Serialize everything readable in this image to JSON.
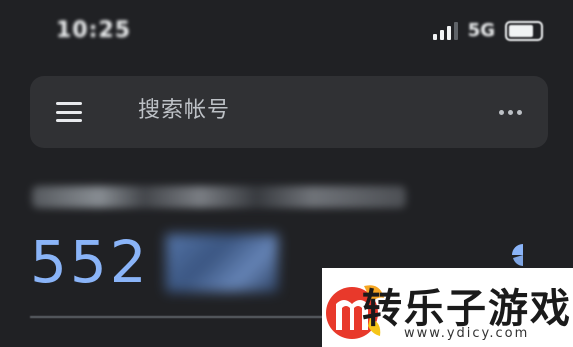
{
  "status_bar": {
    "time": "10:25",
    "network": "5G"
  },
  "search": {
    "placeholder": "搜索帐号"
  },
  "account": {
    "code_visible": "552"
  },
  "watermark": {
    "title": "转乐子游戏",
    "url": "www.ydicy.com"
  },
  "colors": {
    "background": "#202124",
    "search_bar": "#303134",
    "code_blue": "#8ab4f8"
  },
  "icons": {
    "menu": "hamburger-menu-icon",
    "more": "more-horizontal-icon",
    "timer": "countdown-timer-icon",
    "signal": "cell-signal-icon",
    "battery": "battery-icon"
  }
}
